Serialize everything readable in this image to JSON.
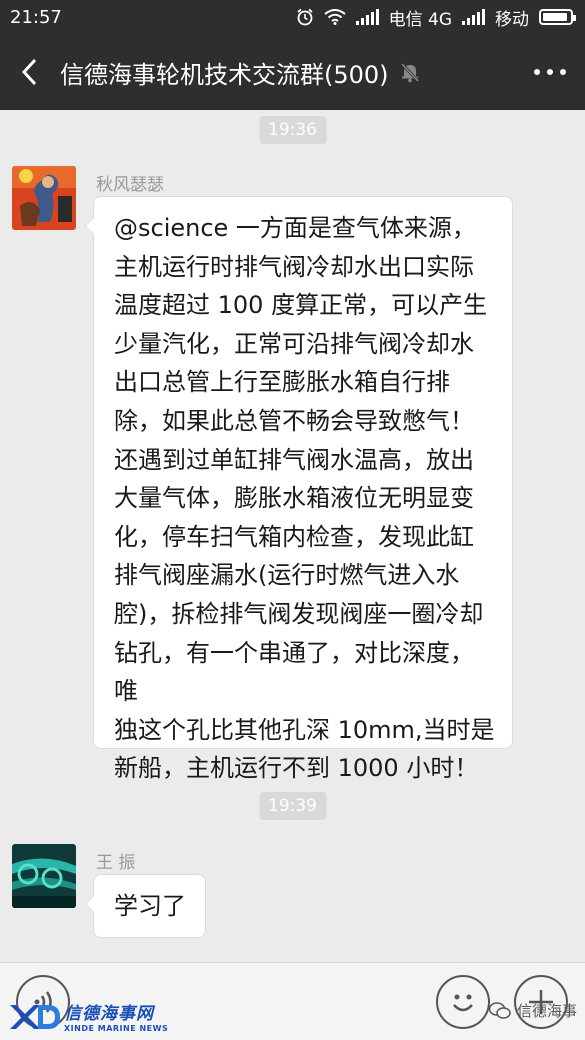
{
  "status_bar": {
    "time": "21:57",
    "carrier1": "电信 4G",
    "carrier2": "移动"
  },
  "nav": {
    "title": "信德海事轮机技术交流群(500)"
  },
  "messages": [
    {
      "time": "19:36",
      "sender": "秋风瑟瑟",
      "lines": [
        "@science 一方面是查气体来源，",
        "主机运行时排气阀冷却水出口实际",
        "温度超过 100 度算正常，可以产生",
        "少量汽化，正常可沿排气阀冷却水",
        "出口总管上行至膨胀水箱自行排",
        "除，如果此总管不畅会导致憋气！",
        "还遇到过单缸排气阀水温高，放出",
        "大量气体，膨胀水箱液位无明显变",
        "化，停车扫气箱内检查，发现此缸",
        "排气阀座漏水(运行时燃气进入水",
        "腔)，拆检排气阀发现阀座一圈冷却",
        "钻孔，有一个串通了，对比深度，唯",
        "独这个孔比其他孔深 10mm,当时是",
        "新船，主机运行不到 1000 小时！"
      ]
    },
    {
      "time": "19:39",
      "sender": "王 振",
      "lines": [
        "学习了"
      ]
    }
  ],
  "footer": {
    "logo_cn": "信德海事网",
    "logo_en": "XINDE MARINE NEWS",
    "watermark": "信德海事"
  },
  "colors": {
    "header_bg": "#2e2e2e",
    "chat_bg": "#ebebeb",
    "logo_blue": "#1b4fb6"
  }
}
